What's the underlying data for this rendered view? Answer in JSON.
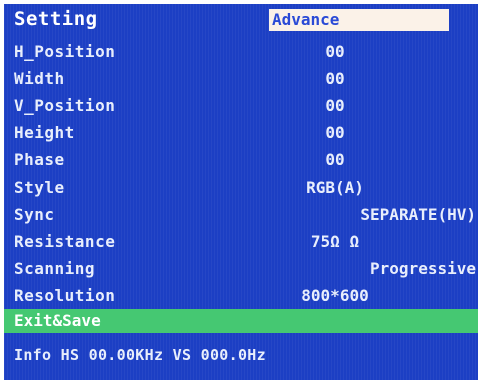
{
  "header": {
    "title": "Setting",
    "tab": "Advance"
  },
  "settings": [
    {
      "label": "H_Position",
      "value": "00"
    },
    {
      "label": "Width",
      "value": "00"
    },
    {
      "label": "V_Position",
      "value": "00"
    },
    {
      "label": "Height",
      "value": "00"
    },
    {
      "label": "Phase",
      "value": "00"
    },
    {
      "label": "Style",
      "value": "RGB(A)"
    },
    {
      "label": "Sync",
      "value": "SEPARATE(HV)"
    },
    {
      "label": "Resistance",
      "value": "75Ω Ω"
    },
    {
      "label": "Scanning",
      "value": "Progressive"
    },
    {
      "label": "Resolution",
      "value": "800*600"
    }
  ],
  "exit": {
    "label": "Exit&Save"
  },
  "info": {
    "text": "Info HS 00.00KHz VS 000.0Hz"
  },
  "colors": {
    "background": "#1c3fc4",
    "highlight": "#45c872",
    "tab_background": "#fbf2e8",
    "text": "#e8eefc"
  }
}
